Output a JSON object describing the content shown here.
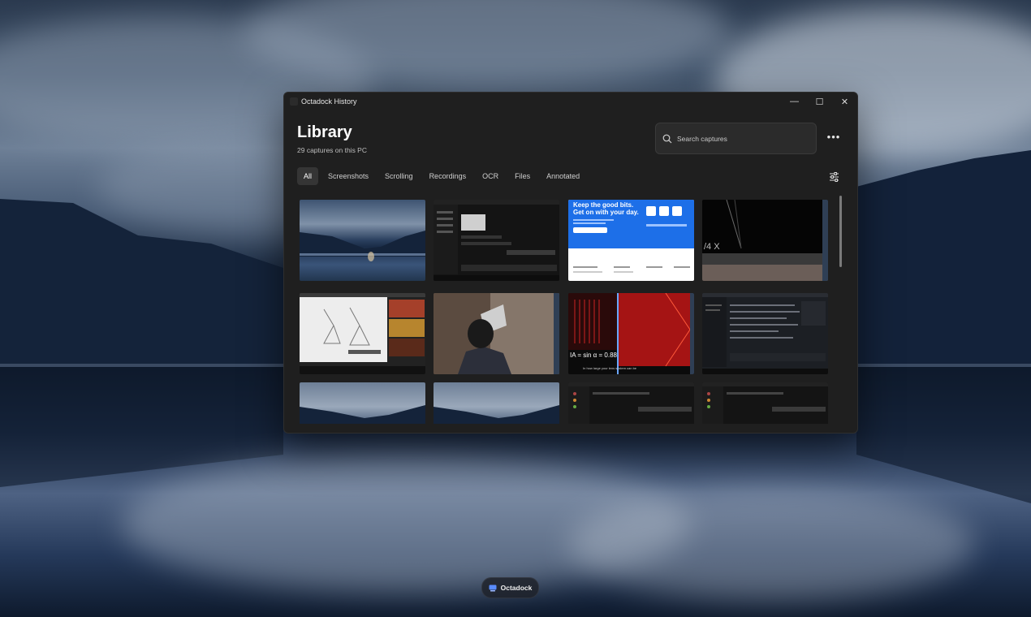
{
  "window": {
    "title": "Octadock History",
    "heading": "Library",
    "subtitle": "29 captures on this PC",
    "controls": {
      "minimize": "—",
      "maximize": "☐",
      "close": "✕"
    }
  },
  "search": {
    "placeholder": "Search captures",
    "value": ""
  },
  "more_label": "•••",
  "tabs": [
    {
      "label": "All",
      "active": true
    },
    {
      "label": "Screenshots",
      "active": false
    },
    {
      "label": "Scrolling",
      "active": false
    },
    {
      "label": "Recordings",
      "active": false
    },
    {
      "label": "OCR",
      "active": false
    },
    {
      "label": "Files",
      "active": false
    },
    {
      "label": "Annotated",
      "active": false
    }
  ],
  "thumbnails": {
    "blue_page": {
      "headline_1": "Keep the good bits.",
      "headline_2": "Get on with your day."
    },
    "lecture": {
      "formula": "IA = sin α = 0.88",
      "caption": "In how large your lens system can be"
    },
    "dark_graphic": {
      "glyph": "/4 X"
    }
  },
  "taskbar": {
    "app_label": "Octadock"
  }
}
